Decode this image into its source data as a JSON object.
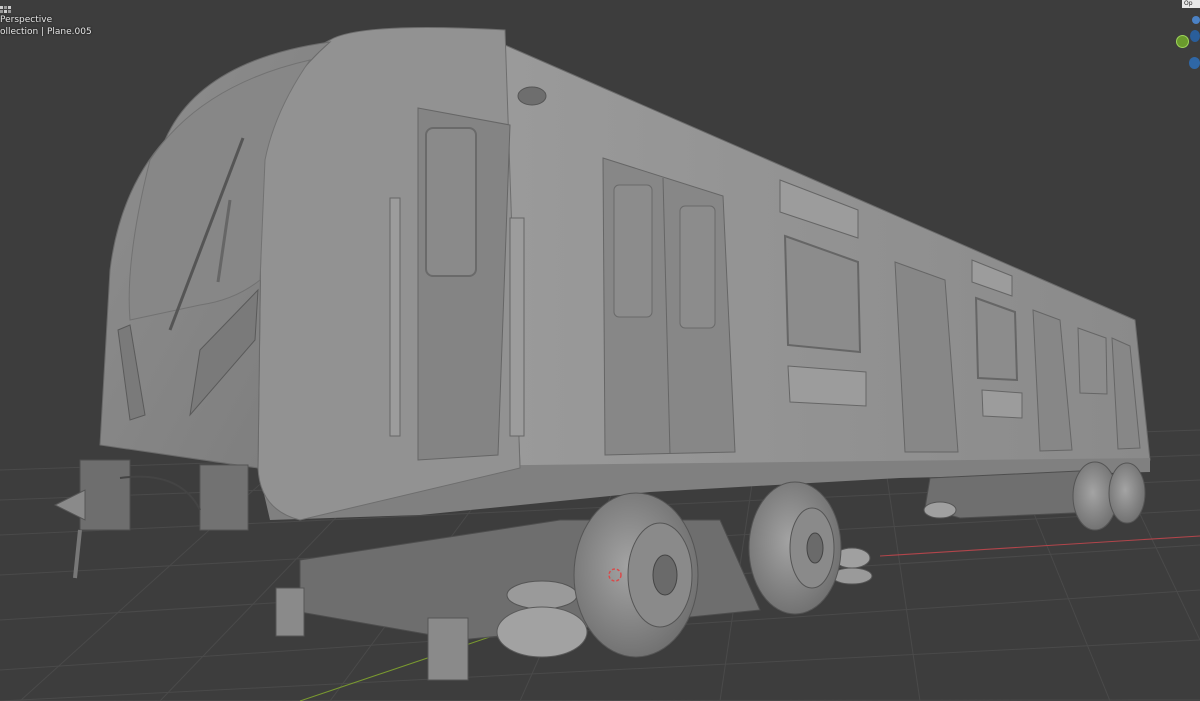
{
  "viewport": {
    "view_mode": "Perspective",
    "object_info": "ollection | Plane.005",
    "gizmo_label": "Op"
  },
  "colors": {
    "background": "#3d3d3d",
    "grid": "#4a4a4a",
    "x_axis": "#b2454b",
    "y_axis": "#7a9a2f",
    "model": "#8e8e8e",
    "gizmo_green": "#6a9a2d",
    "gizmo_blue": "#2f67a6"
  },
  "icons": [
    "toggle-icons",
    "navigation-gizmo",
    "origin-marker-icon"
  ]
}
